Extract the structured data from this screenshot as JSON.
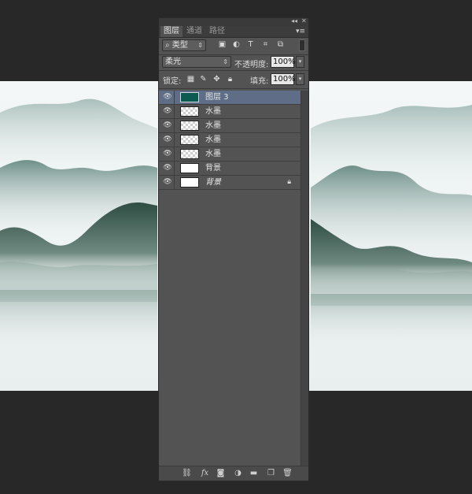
{
  "colors": {
    "panel_bg": "#535353",
    "selected_layer": "#5f6e86",
    "app_bg": "#282828",
    "canvas_bg": "#eef3f3"
  },
  "titlebar": {
    "collapse_icon": "double-chevron-left-icon",
    "close_icon": "close-icon"
  },
  "tabs": [
    {
      "label": "图层",
      "active": true
    },
    {
      "label": "通道",
      "active": false
    },
    {
      "label": "路径",
      "active": false
    }
  ],
  "panel_menu_icon": "panel-menu-icon",
  "filter": {
    "kind_label": "类型",
    "icons": [
      "image-filter-icon",
      "adjustment-filter-icon",
      "text-filter-icon",
      "shape-filter-icon",
      "smart-object-filter-icon"
    ]
  },
  "blend": {
    "mode": "柔光",
    "opacity_label": "不透明度:",
    "opacity_value": "100%"
  },
  "lock": {
    "label": "锁定:",
    "icons": [
      "lock-transparent-icon",
      "lock-brush-icon",
      "lock-move-icon",
      "lock-all-icon"
    ],
    "fill_label": "填充:",
    "fill_value": "100%"
  },
  "layers": [
    {
      "name": "图层 3",
      "thumb": "teal",
      "selected": true,
      "italic": false,
      "locked": false
    },
    {
      "name": "水墨",
      "thumb": "checker",
      "selected": false,
      "italic": false,
      "locked": false
    },
    {
      "name": "水墨",
      "thumb": "checker",
      "selected": false,
      "italic": false,
      "locked": false
    },
    {
      "name": "水墨",
      "thumb": "checker",
      "selected": false,
      "italic": false,
      "locked": false
    },
    {
      "name": "水墨",
      "thumb": "checker",
      "selected": false,
      "italic": false,
      "locked": false
    },
    {
      "name": "背景",
      "thumb": "white",
      "selected": false,
      "italic": false,
      "locked": false
    },
    {
      "name": "背景",
      "thumb": "white",
      "selected": false,
      "italic": true,
      "locked": true
    }
  ],
  "bottom_icons": [
    "link-layers-icon",
    "fx-icon",
    "add-mask-icon",
    "adjustment-layer-icon",
    "new-group-icon",
    "new-layer-icon",
    "trash-icon"
  ]
}
